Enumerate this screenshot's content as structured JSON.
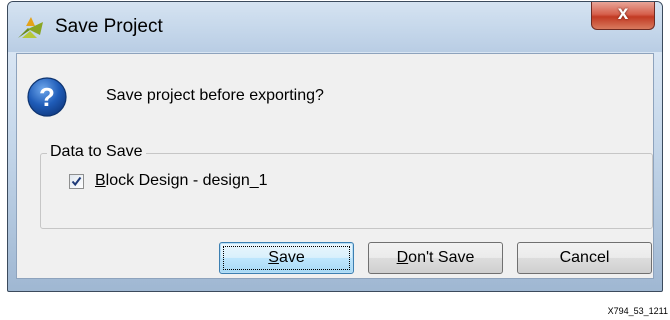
{
  "window": {
    "title": "Save Project",
    "app_icon": "vivado-logo-icon",
    "close_glyph": "x"
  },
  "dialog": {
    "icon": "question-icon",
    "message": "Save project before exporting?",
    "group_title": "Data to Save",
    "items": [
      {
        "label_mnemonic": "B",
        "label_rest": "lock Design - design_1",
        "checked": true
      }
    ]
  },
  "buttons": {
    "save": {
      "mnemonic": "S",
      "rest": "ave"
    },
    "dont_save": {
      "mnemonic": "D",
      "rest": "on't Save"
    },
    "cancel": {
      "label": "Cancel"
    }
  },
  "figure_id": "X794_53_1211",
  "colors": {
    "title_gradient_top": "#d5e3f1",
    "client_bg": "#f0f0f0",
    "close_red": "#c23a23",
    "default_button_border": "#3c7fb1"
  }
}
